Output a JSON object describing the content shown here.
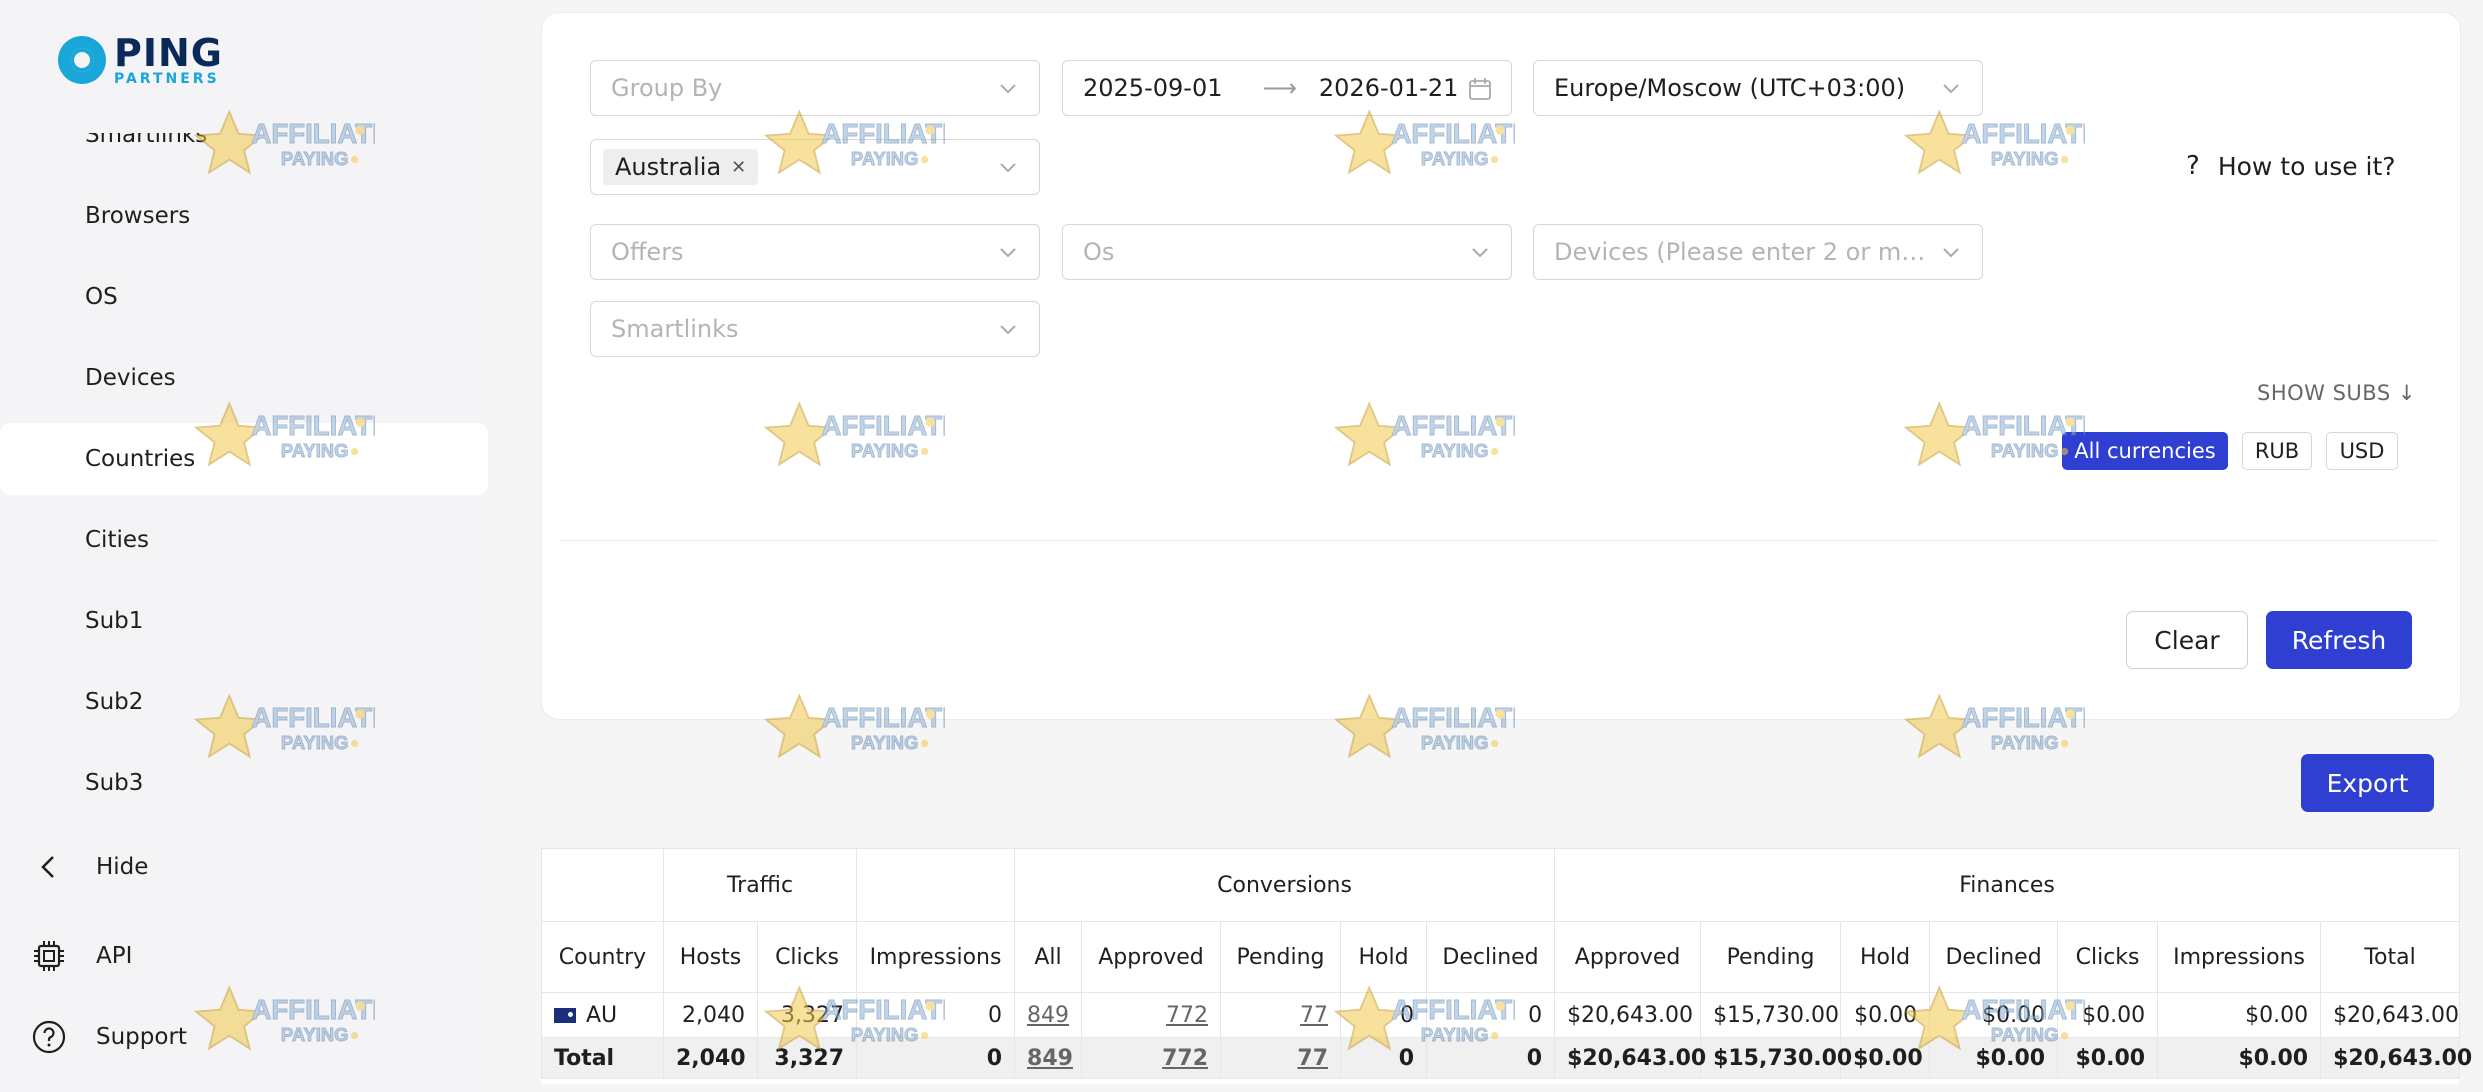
{
  "brand": {
    "name": "PING",
    "tagline": "PARTNERS"
  },
  "sidebar": {
    "items": [
      {
        "label": "Smartlinks"
      },
      {
        "label": "Browsers"
      },
      {
        "label": "OS"
      },
      {
        "label": "Devices"
      },
      {
        "label": "Countries",
        "active": true
      },
      {
        "label": "Cities"
      },
      {
        "label": "Sub1"
      },
      {
        "label": "Sub2"
      },
      {
        "label": "Sub3"
      }
    ],
    "hide_label": "Hide",
    "api_label": "API",
    "support_label": "Support"
  },
  "filters": {
    "group_by_placeholder": "Group By",
    "date_from": "2025-09-01",
    "date_to": "2026-01-21",
    "timezone": "Europe/Moscow (UTC+03:00)",
    "country_tag": "Australia",
    "offers_placeholder": "Offers",
    "os_placeholder": "Os",
    "devices_placeholder": "Devices (Please enter 2 or mo...",
    "smartlinks_placeholder": "Smartlinks",
    "help_label": "How to use it?",
    "show_subs_label": "SHOW SUBS",
    "currencies": [
      "All currencies",
      "RUB",
      "USD"
    ],
    "active_currency": "All currencies",
    "clear_label": "Clear",
    "refresh_label": "Refresh"
  },
  "export_label": "Export",
  "watermark": "AFFILIATE PAYING",
  "table": {
    "groups": {
      "traffic": "Traffic",
      "conversions": "Conversions",
      "finances": "Finances"
    },
    "columns": [
      "Country",
      "Hosts",
      "Clicks",
      "Impressions",
      "All",
      "Approved",
      "Pending",
      "Hold",
      "Declined",
      "Approved",
      "Pending",
      "Hold",
      "Declined",
      "Clicks",
      "Impressions",
      "Total"
    ],
    "rows": [
      [
        "AU",
        "2,040",
        "3,327",
        "0",
        "849",
        "772",
        "77",
        "0",
        "0",
        "$20,643.00",
        "$15,730.00",
        "$0.00",
        "$0.00",
        "$0.00",
        "$0.00",
        "$20,643.00"
      ]
    ],
    "total": [
      "Total",
      "2,040",
      "3,327",
      "0",
      "849",
      "772",
      "77",
      "0",
      "0",
      "$20,643.00",
      "$15,730.00",
      "$0.00",
      "$0.00",
      "$0.00",
      "$0.00",
      "$20,643.00"
    ]
  },
  "colors": {
    "primary": "#2f3fd1",
    "brand_cyan": "#18a7d8",
    "brand_navy": "#0b2a5a"
  }
}
